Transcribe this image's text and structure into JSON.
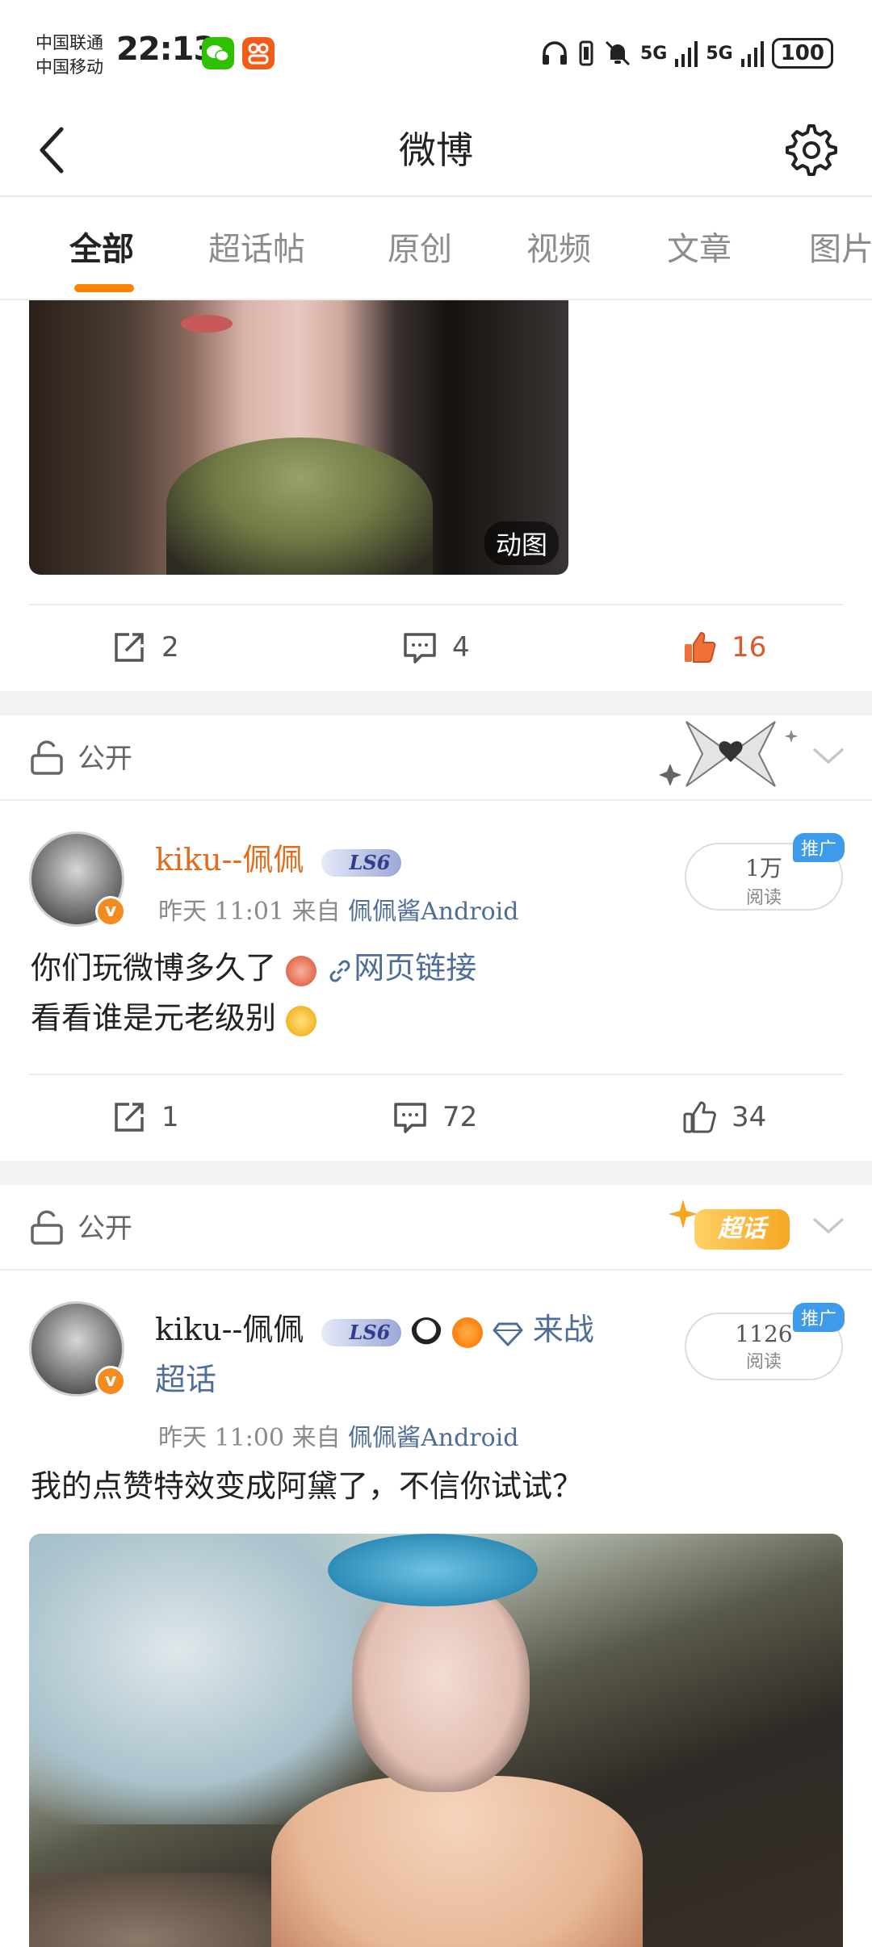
{
  "status_bar": {
    "carrier1": "中国联通",
    "carrier2": "中国移动",
    "time": "22:13",
    "network1": "5G",
    "network2": "5G",
    "battery": "100"
  },
  "header": {
    "title": "微博"
  },
  "tabs": [
    "全部",
    "超话帖",
    "原创",
    "视频",
    "文章",
    "图片"
  ],
  "feed": {
    "post0": {
      "image_badge": "动图",
      "reposts": "2",
      "comments": "4",
      "likes": "16"
    },
    "post1": {
      "privacy": "公开",
      "username": "kiku--佩佩",
      "level": "LS6",
      "time": "昨天 11:01",
      "from_label": "来自",
      "source": "佩佩酱Android",
      "reads_num": "1万",
      "reads_label": "阅读",
      "promo": "推广",
      "text_line1": "你们玩微博多久了",
      "link_text": "网页链接",
      "text_line2": "看看谁是元老级别",
      "reposts": "1",
      "comments": "72",
      "likes": "34"
    },
    "post2": {
      "privacy": "公开",
      "deco_label": "超话",
      "username": "kiku--佩佩",
      "level": "LS6",
      "tag_part1": "来战",
      "tag_part2": "超话",
      "time": "昨天 11:00",
      "from_label": "来自",
      "source": "佩佩酱Android",
      "reads_num": "1126",
      "reads_label": "阅读",
      "promo": "推广",
      "text": "我的点赞特效变成阿黛了，不信你试试？"
    }
  },
  "colors": {
    "accent": "#ff8200",
    "liked": "#e1562b",
    "username_vip": "#e36c1a",
    "link": "#4e6d98",
    "promo": "#3d9be9"
  }
}
